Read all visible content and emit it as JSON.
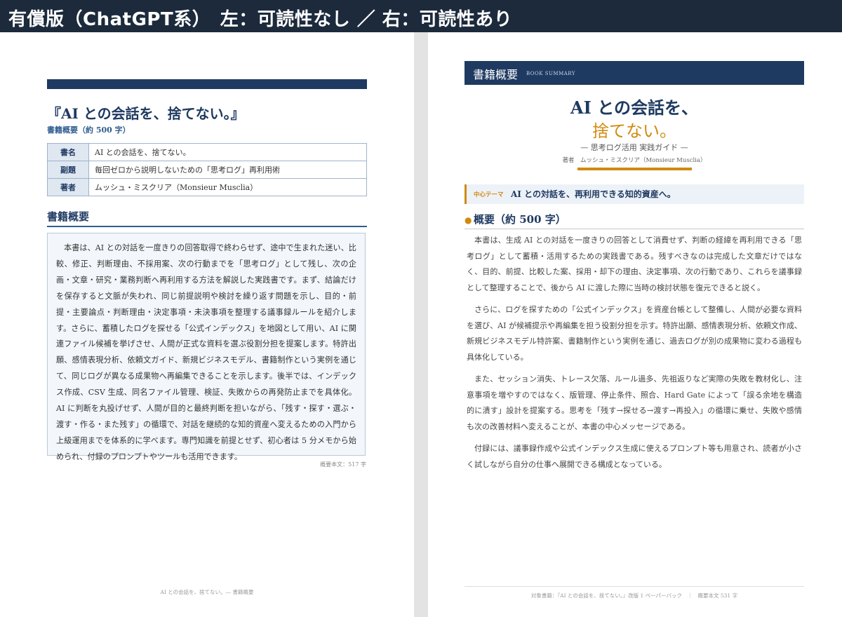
{
  "banner": {
    "title": "有償版（ChatGPT系）　左：可読性なし ／ 右：可読性あり"
  },
  "left_page": {
    "title": "『AI との会話を、捨てない。』",
    "subtitle": "書籍概要（約 500 字）",
    "info_table": [
      {
        "key": "書名",
        "value": "AI との会話を、捨てない。"
      },
      {
        "key": "副題",
        "value": "毎回ゼロから説明しないための「思考ログ」再利用術"
      },
      {
        "key": "著者",
        "value": "ムッシュ・ミスクリア（Monsieur Musclia）"
      }
    ],
    "section_heading": "書籍概要",
    "summary": "本書は、AI との対話を一度きりの回答取得で終わらせず、途中で生まれた迷い、比較、修正、判断理由、不採用案、次の行動までを「思考ログ」として残し、次の企画・文章・研究・業務判断へ再利用する方法を解説した実践書です。まず、結論だけを保存すると文脈が失われ、同じ前提説明や検討を繰り返す問題を示し、目的・前提・主要論点・判断理由・決定事項・未決事項を整理する議事録ルールを紹介します。さらに、蓄積したログを探せる「公式インデックス」を地図として用い、AI に関連ファイル候補を挙げさせ、人間が正式な資料を選ぶ役割分担を提案します。特許出願、感情表現分析、依頼文ガイド、新規ビジネスモデル、書籍制作という実例を通じて、同じログが異なる成果物へ再編集できることを示します。後半では、インデックス作成、CSV 生成、同名ファイル管理、検証、失敗からの再発防止までを具体化。AI に判断を丸投げせず、人間が目的と最終判断を担いながら、「残す・探す・選ぶ・渡す・作る・また残す」の循環で、対話を継続的な知的資産へ変えるための入門から上級運用までを体系的に学べます。専門知識を前提とせず、初心者は 5 分メモから始められ、付録のプロンプトやツールも活用できます。",
    "char_count": "概要本文：517 字",
    "footer": "AI との会話を、捨てない。— 書籍概要"
  },
  "right_page": {
    "header_title": "書籍概要",
    "header_sub": "BOOK SUMMARY",
    "title_line1": "AI との会話を、",
    "title_line2": "捨てない。",
    "title_sub": "— 思考ログ活用 実践ガイド —",
    "author": "著者　ムッシュ・ミスクリア（Monsieur Musclia）",
    "theme_label": "中心テーマ",
    "theme_text": "AI との対話を、再利用できる知的資産へ。",
    "section_heading": "概要（約 500 字）",
    "paragraphs": [
      "本書は、生成 AI との対話を一度きりの回答として消費せず、判断の経緯を再利用できる「思考ログ」として蓄積・活用するための実践書である。残すべきなのは完成した文章だけではなく、目的、前提、比較した案、採用・却下の理由、決定事項、次の行動であり、これらを議事録として整理することで、後から AI に渡した際に当時の検討状態を復元できると説く。",
      "さらに、ログを探すための「公式インデックス」を資産台帳として整備し、人間が必要な資料を選び、AI が候補提示や再編集を担う役割分担を示す。特許出願、感情表現分析、依頼文作成、新規ビジネスモデル特許案、書籍制作という実例を通じ、過去ログが別の成果物に変わる過程も具体化している。",
      "また、セッション消失、トレース欠落、ルール過多、先祖返りなど実際の失敗を教材化し、注意事項を増やすのではなく、版管理、停止条件、照合、Hard Gate によって「誤る余地を構造的に潰す」設計を提案する。思考を「残す→探せる→渡す→再投入」の循環に乗せ、失敗や感情も次の改善材料へ変えることが、本書の中心メッセージである。",
      "付録には、議事録作成や公式インデックス生成に使えるプロンプト等も用意され、読者が小さく試しながら自分の仕事へ展開できる構成となっている。"
    ],
    "footer": "対象書籍：『AI との会話を、捨てない。』改版 1 ペーパーバック　｜　概要本文 531 字"
  }
}
